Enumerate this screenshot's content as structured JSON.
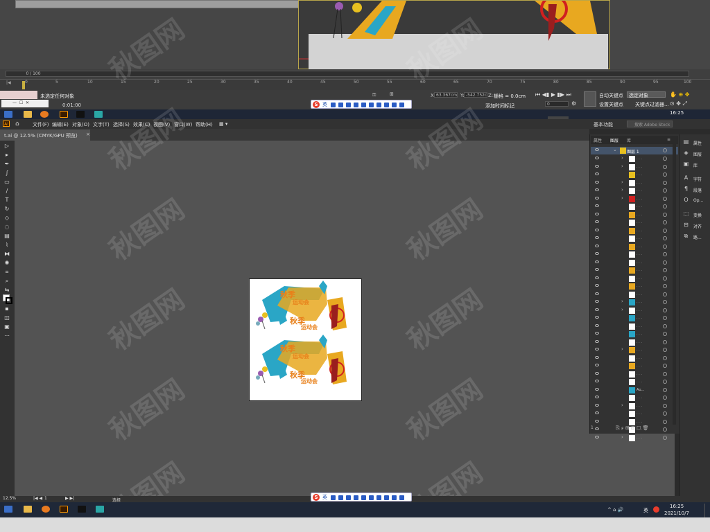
{
  "max": {
    "frame_counter": "0 / 100",
    "ruler_ticks": [
      "0",
      "5",
      "10",
      "15",
      "20",
      "25",
      "30",
      "35",
      "40",
      "45",
      "50",
      "55",
      "60",
      "65",
      "70",
      "75",
      "80",
      "85",
      "90",
      "95",
      "100"
    ],
    "status_text": "未选定任何对象",
    "time_text": "0:01:00",
    "coord_x": "X:",
    "coord_x_val": "63.367cm",
    "coord_y": "Y:",
    "coord_y_val": "-542.752c",
    "coord_z": "Z:",
    "coord_z_val": "0.0cm",
    "grid_label": "栅格 = 0.0cm",
    "add_time_tag": "添加时间标记",
    "autokey": "自动关键点",
    "setkey": "设置关键点",
    "selected_dropdown": "选定对象",
    "filter": "关键点过滤器...",
    "spinner_val": "0"
  },
  "taskbar1": {
    "time": "16:25"
  },
  "ime": {
    "lang": "英"
  },
  "ai": {
    "logo": "Ai",
    "menu": [
      "文件(F)",
      "编辑(E)",
      "对象(O)",
      "文字(T)",
      "选择(S)",
      "效果(C)",
      "视图(V)",
      "窗口(W)",
      "帮助(H)"
    ],
    "workspace": "基本功能",
    "search_placeholder": "搜索 Adobe Stock",
    "doc_tab": "t.ai @ 12.5% (CMYK/GPU 预览)",
    "doc_close": "×",
    "zoom": "12.5%",
    "page": "1",
    "status_tool": "选择"
  },
  "layers": {
    "tabs": [
      "属性",
      "图层",
      "库"
    ],
    "layer_name": "图层 1",
    "sub_label": "Au..."
  },
  "props": {
    "items": [
      "属性",
      "图层",
      "库",
      "字符",
      "段落",
      "Op...",
      "变换",
      "对齐",
      "路..."
    ]
  },
  "artwork": {
    "title1": "秋季",
    "title2": "运动会"
  },
  "taskbar2": {
    "time": "16:25",
    "date": "2021/10/7",
    "ime": "英"
  },
  "watermark": "秋图网"
}
